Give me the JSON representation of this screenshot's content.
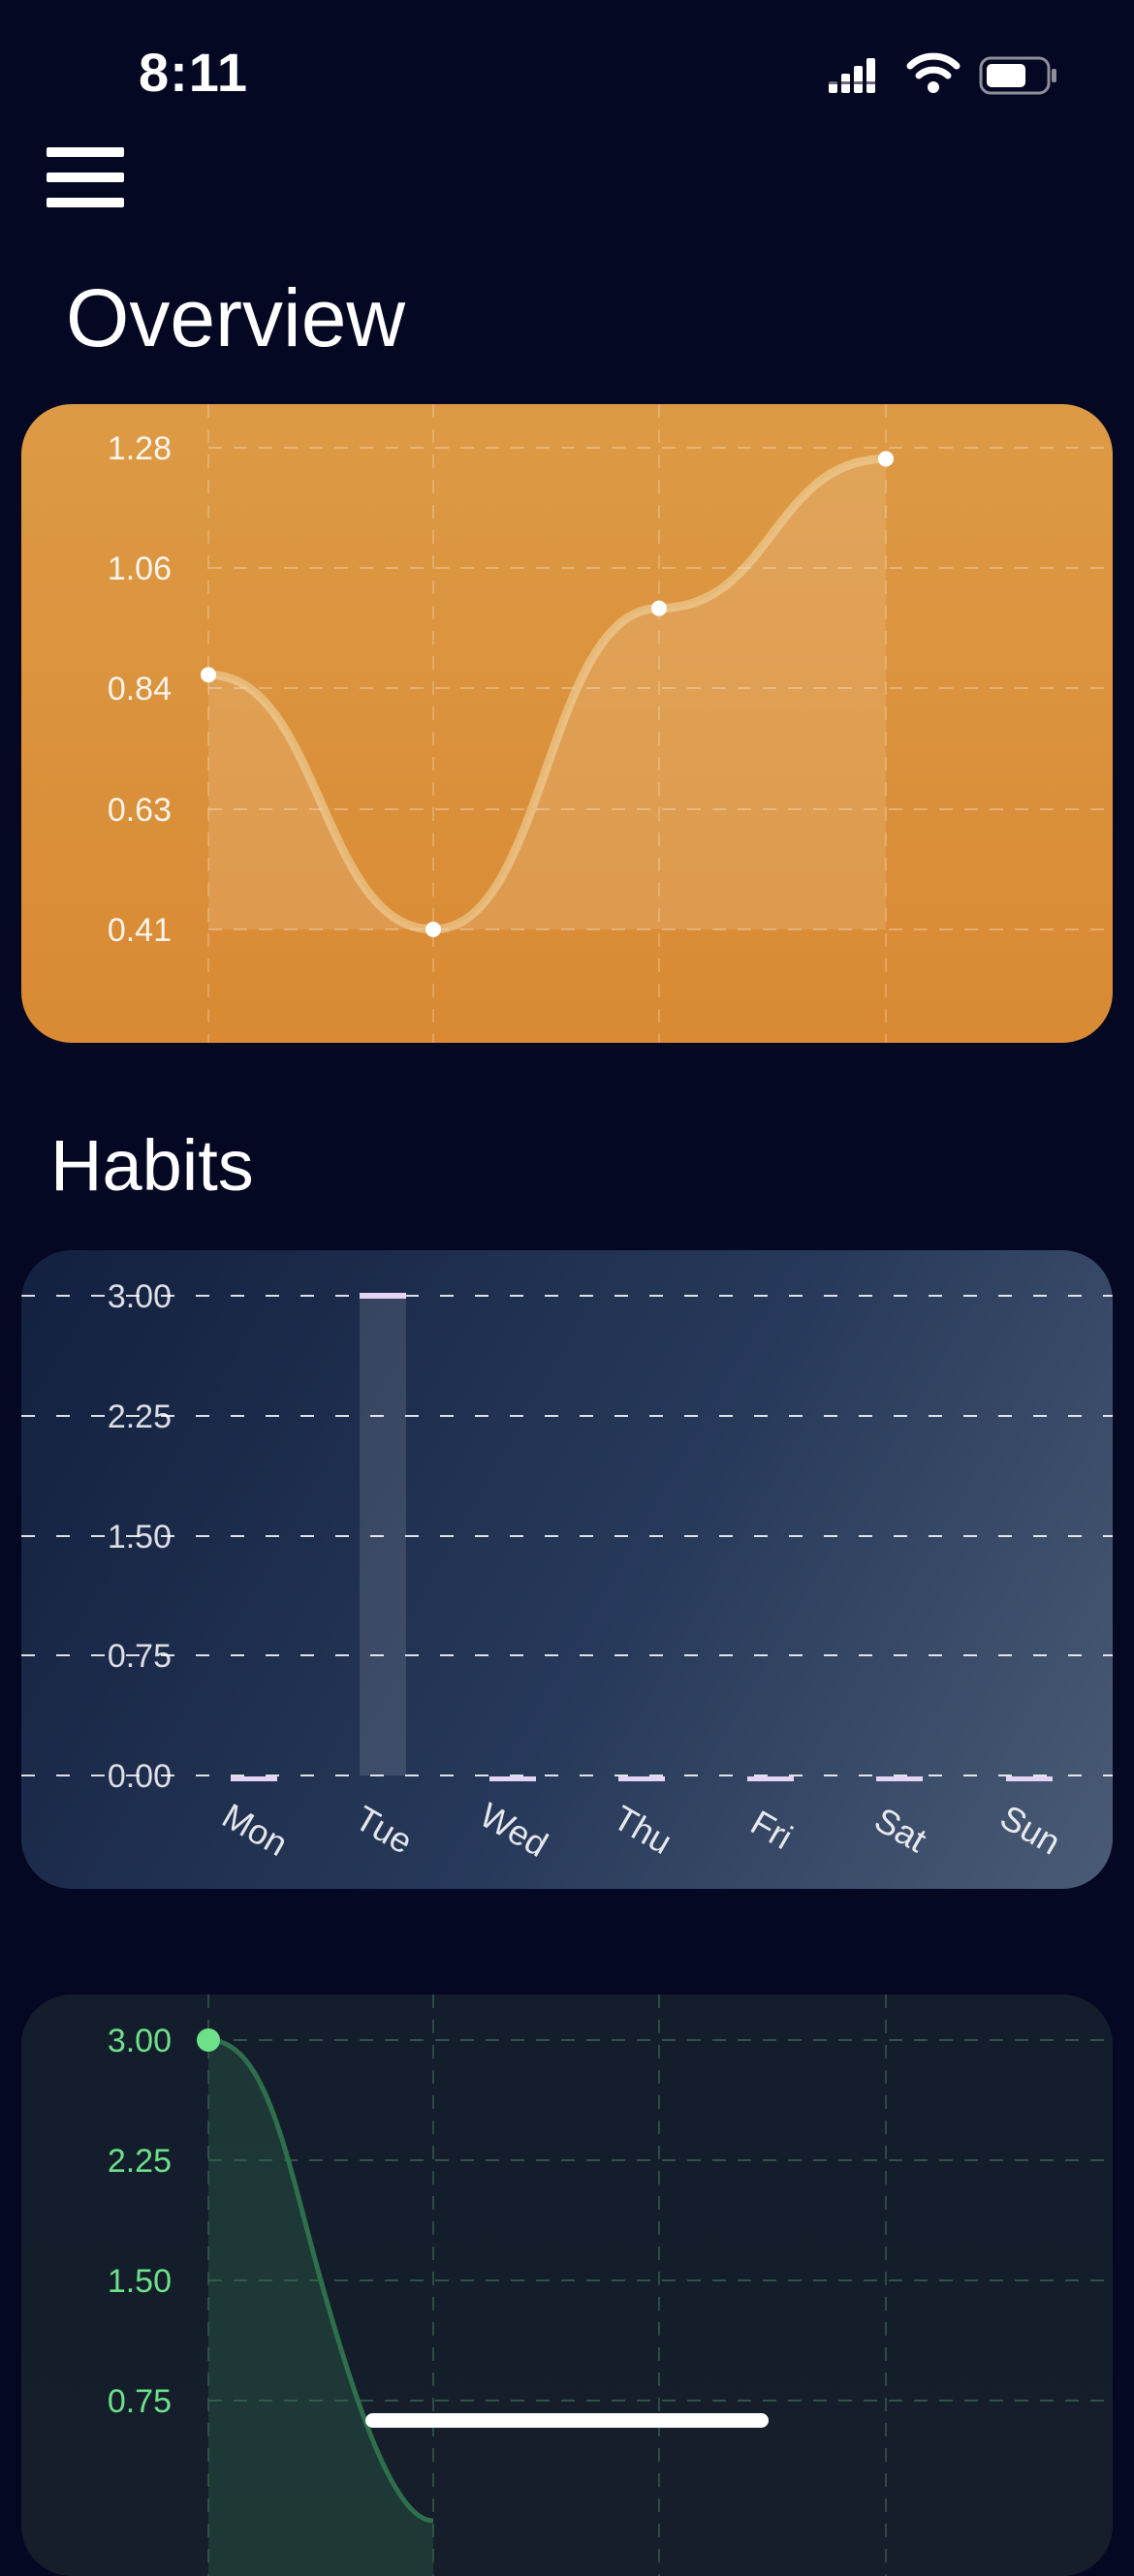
{
  "status_bar": {
    "time": "8:11"
  },
  "header": {
    "menu_icon": "hamburger-menu-icon"
  },
  "overview": {
    "title": "Overview",
    "chart_data": {
      "type": "line",
      "x": [
        0,
        1,
        2,
        3
      ],
      "values": [
        0.87,
        0.41,
        0.99,
        1.26
      ],
      "yticks": [
        "1.28",
        "1.06",
        "0.84",
        "0.63",
        "0.41"
      ],
      "ylim": [
        0.41,
        1.28
      ],
      "grid": true,
      "color": "#f3d9a6"
    }
  },
  "habits": {
    "title": "Habits",
    "chart_data": {
      "type": "bar",
      "categories": [
        "Mon",
        "Tue",
        "Wed",
        "Thu",
        "Fri",
        "Sat",
        "Sun"
      ],
      "values": [
        0,
        3,
        0,
        0,
        0,
        0,
        0
      ],
      "yticks": [
        "3.00",
        "2.25",
        "1.50",
        "0.75",
        "0.00"
      ],
      "ylim": [
        0,
        3
      ],
      "grid": true,
      "color": "#e5d4f5"
    }
  },
  "third": {
    "chart_data": {
      "type": "area",
      "x": [
        0,
        1
      ],
      "values": [
        3.0,
        0.0
      ],
      "yticks": [
        "3.00",
        "2.25",
        "1.50",
        "0.75"
      ],
      "ylim": [
        0,
        3
      ],
      "grid": true,
      "color": "#6ee08a"
    }
  }
}
